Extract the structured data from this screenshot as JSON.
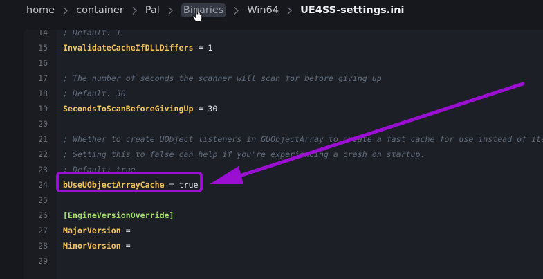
{
  "breadcrumb": {
    "items": [
      {
        "label": "home"
      },
      {
        "label": "container"
      },
      {
        "label": "Pal"
      },
      {
        "label": "Binaries"
      },
      {
        "label": "Win64"
      },
      {
        "label": "UE4SS-settings.ini"
      }
    ]
  },
  "editor": {
    "lines": [
      {
        "n": "14",
        "text": "; Default: 1"
      },
      {
        "n": "15",
        "key": "InvalidateCacheIfDLLDiffers",
        "op": " = ",
        "value": "1"
      },
      {
        "n": "16"
      },
      {
        "n": "17",
        "text": "; The number of seconds the scanner will scan for before giving up"
      },
      {
        "n": "18",
        "text": "; Default: 30"
      },
      {
        "n": "19",
        "key": "SecondsToScanBeforeGivingUp",
        "op": " = ",
        "value": "30"
      },
      {
        "n": "20"
      },
      {
        "n": "21",
        "text": "; Whether to create UObject listeners in GUObjectArray to create a fast cache for use instead of iterating"
      },
      {
        "n": "22",
        "text": "; Setting this to false can help if you're experiencing a crash on startup."
      },
      {
        "n": "23",
        "text": "; Default: true"
      },
      {
        "n": "24",
        "key": "bUseUObjectArrayCache",
        "op": " = ",
        "value": "true"
      },
      {
        "n": "25"
      },
      {
        "n": "26",
        "section": "[EngineVersionOverride]"
      },
      {
        "n": "27",
        "key": "MajorVersion",
        "op": " =",
        "value": ""
      },
      {
        "n": "28",
        "key": "MinorVersion",
        "op": " =",
        "value": ""
      },
      {
        "n": "29"
      }
    ]
  },
  "colors": {
    "annotation": "#9a0fd1",
    "key": "#f2c55c",
    "section": "#a4df6e",
    "comment": "#5f6b7a"
  }
}
